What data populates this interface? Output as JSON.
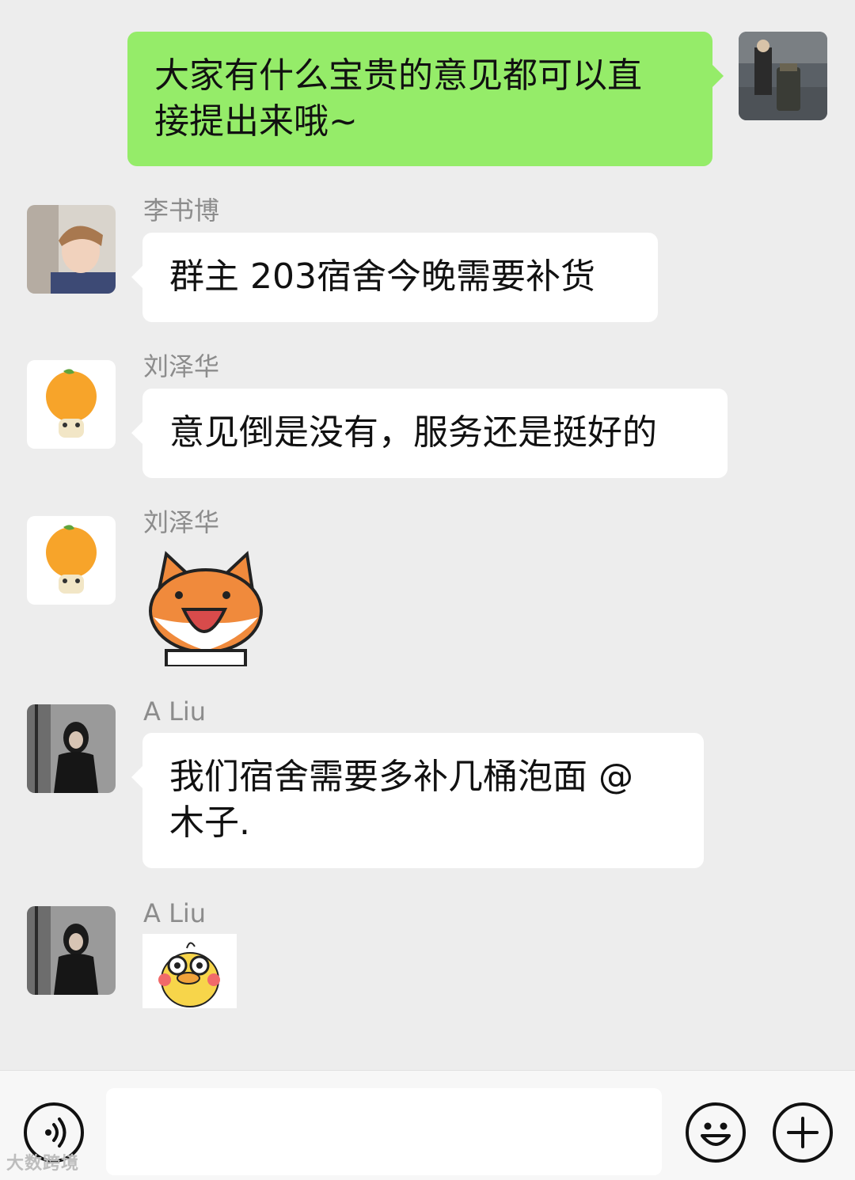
{
  "messages": [
    {
      "side": "out",
      "text_line1": "大家有什么宝贵的意见都可以直",
      "text_line2": "接提出来哦~",
      "avatar": "photo-avatar"
    },
    {
      "sender": "李书博",
      "text": "群主 203宿舍今晚需要补货",
      "avatar": "boy-photo-avatar"
    },
    {
      "sender": "刘泽华",
      "text": "意见倒是没有，服务还是挺好的",
      "avatar": "orange-avatar"
    },
    {
      "sender": "刘泽华",
      "sticker": "fox-sticker",
      "avatar": "orange-avatar"
    },
    {
      "sender": "A Liu",
      "text_line1": "我们宿舍需要多补几桶泡面  @",
      "text_line2": "木子.",
      "avatar": "girl-photo-avatar"
    },
    {
      "sender": "A Liu",
      "sticker": "duck-sticker",
      "avatar": "girl-photo-avatar"
    }
  ],
  "input_bar": {
    "voice_icon": "voice-icon",
    "emoji_icon": "emoji-icon",
    "plus_icon": "plus-icon",
    "input_value": ""
  },
  "watermark": "大数跨境"
}
